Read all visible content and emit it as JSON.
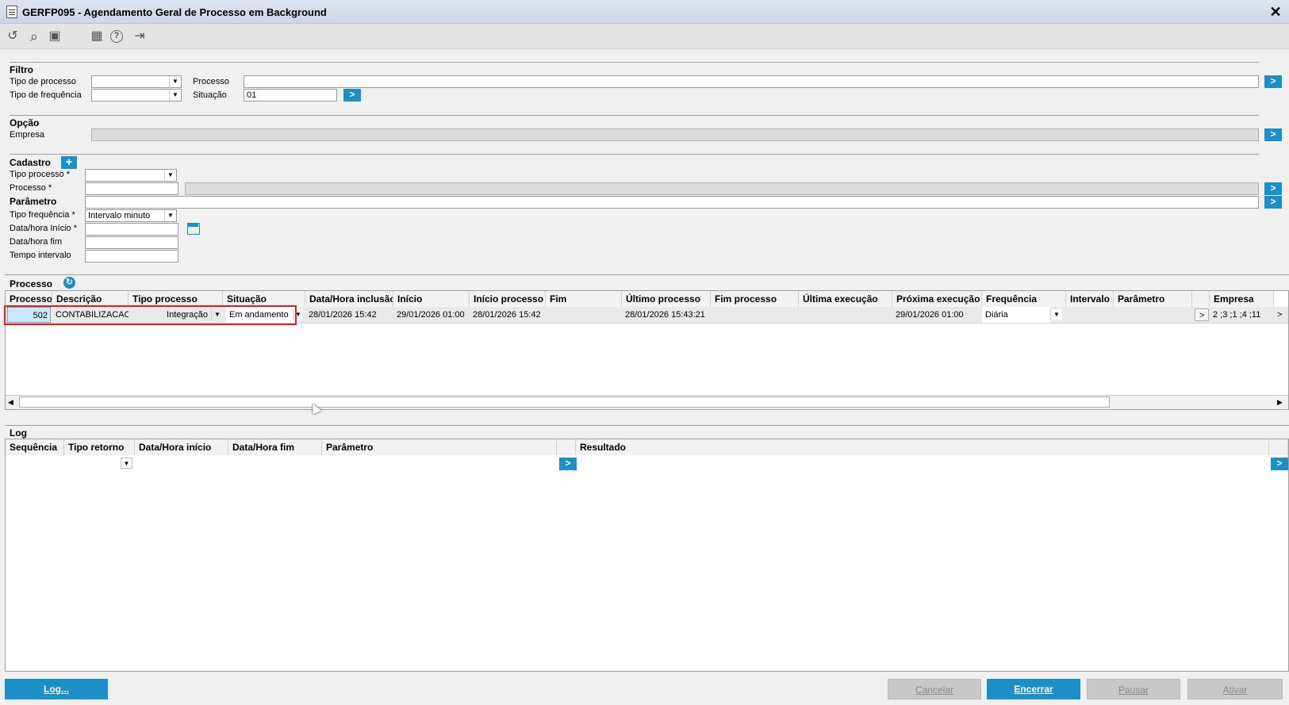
{
  "window": {
    "title": "GERFP095 - Agendamento Geral de Processo em Background",
    "close": "✕"
  },
  "toolbar": {
    "icons": [
      "undo-icon",
      "search-icon",
      "save-icon",
      "calendar-icon",
      "help-icon",
      "exit-icon"
    ],
    "undo": "↺",
    "search": "⌕",
    "save": "▣",
    "calendar": "▦",
    "help": "?",
    "exit": "⇥"
  },
  "filtro": {
    "title": "Filtro",
    "tipo_processo_label": "Tipo de processo",
    "processo_label": "Processo",
    "tipo_frequencia_label": "Tipo de frequência",
    "situacao_label": "Situação",
    "situacao_value": "01"
  },
  "opcao": {
    "title": "Opção",
    "empresa_label": "Empresa"
  },
  "cadastro": {
    "title": "Cadastro",
    "tipo_processo_label": "Tipo processo *",
    "processo_label": "Processo *",
    "parametro_label": "Parâmetro",
    "tipo_frequencia_label": "Tipo frequência *",
    "tipo_frequencia_value": "Intervalo minuto",
    "data_inicio_label": "Data/hora Início *",
    "data_fim_label": "Data/hora fim",
    "tempo_intervalo_label": "Tempo intervalo"
  },
  "processo_grid": {
    "title": "Processo",
    "columns": [
      "Processo",
      "Descrição",
      "Tipo processo",
      "Situação",
      "Data/Hora inclusão",
      "Início",
      "Início processo",
      "Fim",
      "Último processo",
      "Fim processo",
      "Última execução",
      "Próxima execução",
      "Frequência",
      "Intervalo",
      "Parâmetro",
      "",
      "Empresa"
    ],
    "row": {
      "processo": "502",
      "descricao": "CONTABILIZACAO",
      "tipo_processo": "Integração",
      "situacao": "Em andamento",
      "data_inclusao": "28/01/2026 15:42",
      "inicio": "29/01/2026 01:00",
      "inicio_processo": "28/01/2026 15:42",
      "fim": "",
      "ultimo_processo": "28/01/2026 15:43:21",
      "fim_processo": "",
      "ultima_execucao": "",
      "proxima_execucao": "29/01/2026 01:00",
      "frequencia": "Diária",
      "intervalo": "",
      "parametro": "",
      "param_btn": ">",
      "empresa": "2 ;3 ;1 ;4 ;11"
    }
  },
  "log_grid": {
    "title": "Log",
    "columns": [
      "Sequência",
      "Tipo retorno",
      "Data/Hora início",
      "Data/Hora fim",
      "Parâmetro",
      "",
      "Resultado"
    ]
  },
  "footer": {
    "log": "Log...",
    "cancelar": "Cancelar",
    "encerrar": "Encerrar",
    "pausar": "Pausar",
    "ativar": "Ativar"
  },
  "colors": {
    "accent": "#1a8fc8",
    "highlight_border": "#e02020",
    "selected_cell": "#cce8ff"
  }
}
